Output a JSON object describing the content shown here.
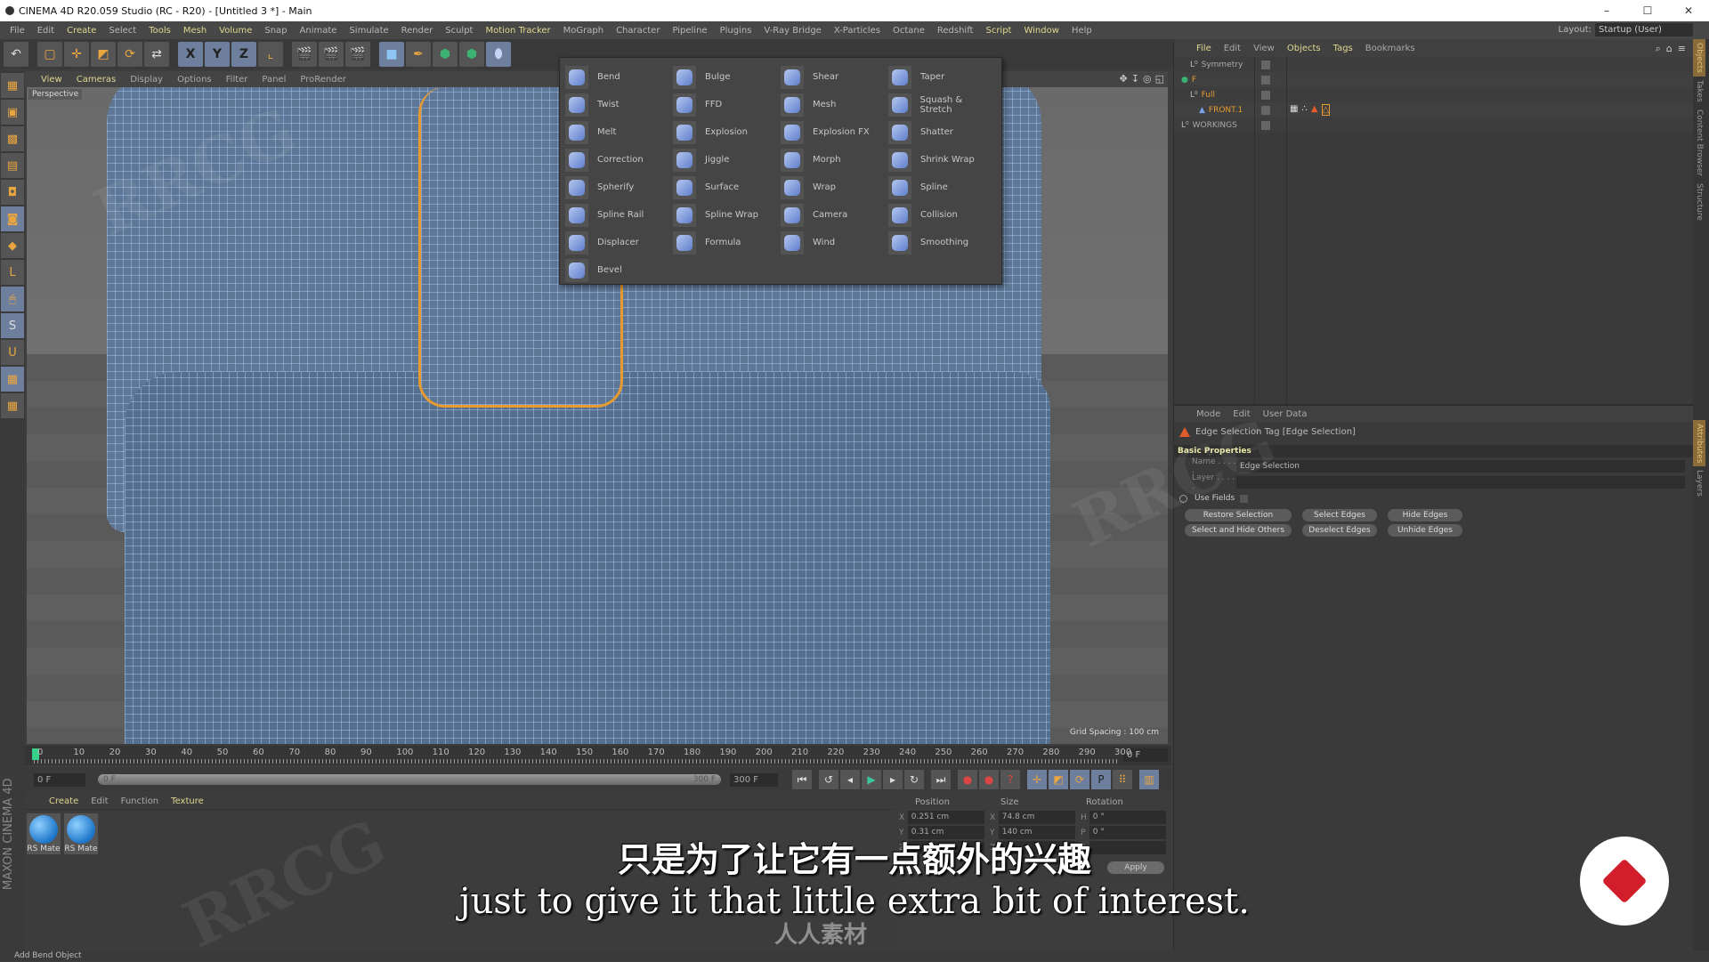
{
  "window": {
    "title": "CINEMA 4D R20.059 Studio (RC - R20) - [Untitled 3 *] - Main",
    "controls": [
      "–",
      "☐",
      "✕"
    ]
  },
  "menubar": {
    "items": [
      {
        "label": "File",
        "hl": false
      },
      {
        "label": "Edit",
        "hl": false
      },
      {
        "label": "Create",
        "hl": true
      },
      {
        "label": "Select",
        "hl": false
      },
      {
        "label": "Tools",
        "hl": true
      },
      {
        "label": "Mesh",
        "hl": true
      },
      {
        "label": "Volume",
        "hl": true
      },
      {
        "label": "Snap",
        "hl": false
      },
      {
        "label": "Animate",
        "hl": false
      },
      {
        "label": "Simulate",
        "hl": false
      },
      {
        "label": "Render",
        "hl": false
      },
      {
        "label": "Sculpt",
        "hl": false
      },
      {
        "label": "Motion Tracker",
        "hl": true
      },
      {
        "label": "MoGraph",
        "hl": false
      },
      {
        "label": "Character",
        "hl": false
      },
      {
        "label": "Pipeline",
        "hl": false
      },
      {
        "label": "Plugins",
        "hl": false
      },
      {
        "label": "V-Ray Bridge",
        "hl": false
      },
      {
        "label": "X-Particles",
        "hl": false
      },
      {
        "label": "Octane",
        "hl": false
      },
      {
        "label": "Redshift",
        "hl": false
      },
      {
        "label": "Script",
        "hl": true
      },
      {
        "label": "Window",
        "hl": true
      },
      {
        "label": "Help",
        "hl": false
      }
    ],
    "layout_label": "Layout:",
    "layout_value": "Startup (User)"
  },
  "toolbar": {
    "undo": "↶",
    "x": "X",
    "y": "Y",
    "z": "Z"
  },
  "viewport": {
    "menu": [
      {
        "label": "View",
        "hl": true
      },
      {
        "label": "Cameras",
        "hl": true
      },
      {
        "label": "Display",
        "hl": false
      },
      {
        "label": "Options",
        "hl": false
      },
      {
        "label": "Filter",
        "hl": false
      },
      {
        "label": "Panel",
        "hl": false
      },
      {
        "label": "ProRender",
        "hl": false
      }
    ],
    "camera_label": "Perspective",
    "grid_spacing": "Grid Spacing : 100 cm"
  },
  "deformer_menu": {
    "items": [
      "Bend",
      "Bulge",
      "Shear",
      "Taper",
      "Twist",
      "FFD",
      "Mesh",
      "Squash & Stretch",
      "Melt",
      "Explosion",
      "Explosion FX",
      "Shatter",
      "Correction",
      "Jiggle",
      "Morph",
      "Shrink Wrap",
      "Spherify",
      "Surface",
      "Wrap",
      "Spline",
      "Spline Rail",
      "Spline Wrap",
      "Camera",
      "Collision",
      "Displacer",
      "Formula",
      "Wind",
      "Smoothing",
      "Bevel"
    ]
  },
  "timeline": {
    "ticks": [
      "0",
      "10",
      "20",
      "30",
      "40",
      "50",
      "60",
      "70",
      "80",
      "90",
      "100",
      "110",
      "120",
      "130",
      "140",
      "150",
      "160",
      "170",
      "180",
      "190",
      "200",
      "210",
      "220",
      "230",
      "240",
      "250",
      "260",
      "270",
      "280",
      "290",
      "300"
    ],
    "current_frame": "0 F",
    "start_field": "0 F",
    "range_start": "0 F",
    "range_end": "300 F",
    "end_field": "300 F"
  },
  "material_manager": {
    "menu": [
      {
        "label": "Create",
        "hl": true
      },
      {
        "label": "Edit",
        "hl": false
      },
      {
        "label": "Function",
        "hl": false
      },
      {
        "label": "Texture",
        "hl": true
      }
    ],
    "materials": [
      "RS Mate",
      "RS Mate"
    ]
  },
  "coordinates": {
    "headers": [
      "Position",
      "Size",
      "Rotation"
    ],
    "rows": [
      {
        "pa": "X",
        "pv": "0.251 cm",
        "sa": "X",
        "sv": "74.8 cm",
        "ra": "H",
        "rv": "0 °"
      },
      {
        "pa": "Y",
        "pv": "0.31 cm",
        "sa": "Y",
        "sv": "140 cm",
        "ra": "P",
        "rv": "0 °"
      },
      {
        "pa": "Z",
        "pv": "",
        "sa": "Z",
        "sv": "",
        "ra": "B",
        "rv": ""
      }
    ],
    "apply": "Apply"
  },
  "object_manager": {
    "menu": [
      {
        "label": "File",
        "hl": true
      },
      {
        "label": "Edit",
        "hl": false
      },
      {
        "label": "View",
        "hl": false
      },
      {
        "label": "Objects",
        "hl": true
      },
      {
        "label": "Tags",
        "hl": true
      },
      {
        "label": "Bookmarks",
        "hl": false
      }
    ],
    "objects": [
      {
        "name": "Symmetry",
        "indent": 1,
        "color": "grey"
      },
      {
        "name": "F",
        "indent": 0,
        "color": "orange"
      },
      {
        "name": "Full",
        "indent": 1,
        "color": "orange"
      },
      {
        "name": "FRONT.1",
        "indent": 2,
        "color": "orange"
      },
      {
        "name": "WORKINGS",
        "indent": 0,
        "color": "grey"
      }
    ]
  },
  "attribute_manager": {
    "menu": [
      "Mode",
      "Edit",
      "User Data"
    ],
    "title": "Edge Selection Tag [Edge Selection]",
    "section": "Basic Properties",
    "name_label": "Name . . . . .",
    "name_value": "Edge Selection",
    "layer_label": "Layer . . . . .",
    "layer_value": "",
    "use_fields": "Use Fields",
    "buttons": [
      "Restore Selection",
      "Select Edges",
      "Hide Edges",
      "Select and Hide Others",
      "Deselect Edges",
      "Unhide Edges"
    ]
  },
  "side_tabs": {
    "top": [
      "Objects",
      "Takes",
      "Content Browser",
      "Structure"
    ],
    "bottom": [
      "Attributes",
      "Layers"
    ]
  },
  "status_bar": "Add Bend Object",
  "subtitles": {
    "chinese": "只是为了让它有一点额外的兴趣",
    "english": "just to give it that little extra bit of interest."
  },
  "watermark": "人人素材",
  "colors": {
    "accent_orange": "#e69a2f",
    "menu_highlight": "#e0d790",
    "selection_blue": "#6d7f9c"
  }
}
